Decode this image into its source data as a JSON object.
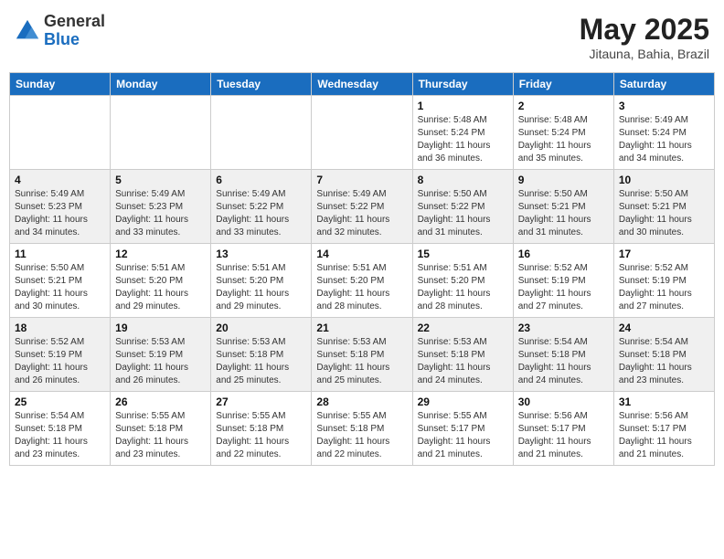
{
  "header": {
    "logo_general": "General",
    "logo_blue": "Blue",
    "month_title": "May 2025",
    "subtitle": "Jitauna, Bahia, Brazil"
  },
  "weekdays": [
    "Sunday",
    "Monday",
    "Tuesday",
    "Wednesday",
    "Thursday",
    "Friday",
    "Saturday"
  ],
  "weeks": [
    [
      {
        "day": "",
        "info": ""
      },
      {
        "day": "",
        "info": ""
      },
      {
        "day": "",
        "info": ""
      },
      {
        "day": "",
        "info": ""
      },
      {
        "day": "1",
        "info": "Sunrise: 5:48 AM\nSunset: 5:24 PM\nDaylight: 11 hours and 36 minutes."
      },
      {
        "day": "2",
        "info": "Sunrise: 5:48 AM\nSunset: 5:24 PM\nDaylight: 11 hours and 35 minutes."
      },
      {
        "day": "3",
        "info": "Sunrise: 5:49 AM\nSunset: 5:24 PM\nDaylight: 11 hours and 34 minutes."
      }
    ],
    [
      {
        "day": "4",
        "info": "Sunrise: 5:49 AM\nSunset: 5:23 PM\nDaylight: 11 hours and 34 minutes."
      },
      {
        "day": "5",
        "info": "Sunrise: 5:49 AM\nSunset: 5:23 PM\nDaylight: 11 hours and 33 minutes."
      },
      {
        "day": "6",
        "info": "Sunrise: 5:49 AM\nSunset: 5:22 PM\nDaylight: 11 hours and 33 minutes."
      },
      {
        "day": "7",
        "info": "Sunrise: 5:49 AM\nSunset: 5:22 PM\nDaylight: 11 hours and 32 minutes."
      },
      {
        "day": "8",
        "info": "Sunrise: 5:50 AM\nSunset: 5:22 PM\nDaylight: 11 hours and 31 minutes."
      },
      {
        "day": "9",
        "info": "Sunrise: 5:50 AM\nSunset: 5:21 PM\nDaylight: 11 hours and 31 minutes."
      },
      {
        "day": "10",
        "info": "Sunrise: 5:50 AM\nSunset: 5:21 PM\nDaylight: 11 hours and 30 minutes."
      }
    ],
    [
      {
        "day": "11",
        "info": "Sunrise: 5:50 AM\nSunset: 5:21 PM\nDaylight: 11 hours and 30 minutes."
      },
      {
        "day": "12",
        "info": "Sunrise: 5:51 AM\nSunset: 5:20 PM\nDaylight: 11 hours and 29 minutes."
      },
      {
        "day": "13",
        "info": "Sunrise: 5:51 AM\nSunset: 5:20 PM\nDaylight: 11 hours and 29 minutes."
      },
      {
        "day": "14",
        "info": "Sunrise: 5:51 AM\nSunset: 5:20 PM\nDaylight: 11 hours and 28 minutes."
      },
      {
        "day": "15",
        "info": "Sunrise: 5:51 AM\nSunset: 5:20 PM\nDaylight: 11 hours and 28 minutes."
      },
      {
        "day": "16",
        "info": "Sunrise: 5:52 AM\nSunset: 5:19 PM\nDaylight: 11 hours and 27 minutes."
      },
      {
        "day": "17",
        "info": "Sunrise: 5:52 AM\nSunset: 5:19 PM\nDaylight: 11 hours and 27 minutes."
      }
    ],
    [
      {
        "day": "18",
        "info": "Sunrise: 5:52 AM\nSunset: 5:19 PM\nDaylight: 11 hours and 26 minutes."
      },
      {
        "day": "19",
        "info": "Sunrise: 5:53 AM\nSunset: 5:19 PM\nDaylight: 11 hours and 26 minutes."
      },
      {
        "day": "20",
        "info": "Sunrise: 5:53 AM\nSunset: 5:18 PM\nDaylight: 11 hours and 25 minutes."
      },
      {
        "day": "21",
        "info": "Sunrise: 5:53 AM\nSunset: 5:18 PM\nDaylight: 11 hours and 25 minutes."
      },
      {
        "day": "22",
        "info": "Sunrise: 5:53 AM\nSunset: 5:18 PM\nDaylight: 11 hours and 24 minutes."
      },
      {
        "day": "23",
        "info": "Sunrise: 5:54 AM\nSunset: 5:18 PM\nDaylight: 11 hours and 24 minutes."
      },
      {
        "day": "24",
        "info": "Sunrise: 5:54 AM\nSunset: 5:18 PM\nDaylight: 11 hours and 23 minutes."
      }
    ],
    [
      {
        "day": "25",
        "info": "Sunrise: 5:54 AM\nSunset: 5:18 PM\nDaylight: 11 hours and 23 minutes."
      },
      {
        "day": "26",
        "info": "Sunrise: 5:55 AM\nSunset: 5:18 PM\nDaylight: 11 hours and 23 minutes."
      },
      {
        "day": "27",
        "info": "Sunrise: 5:55 AM\nSunset: 5:18 PM\nDaylight: 11 hours and 22 minutes."
      },
      {
        "day": "28",
        "info": "Sunrise: 5:55 AM\nSunset: 5:18 PM\nDaylight: 11 hours and 22 minutes."
      },
      {
        "day": "29",
        "info": "Sunrise: 5:55 AM\nSunset: 5:17 PM\nDaylight: 11 hours and 21 minutes."
      },
      {
        "day": "30",
        "info": "Sunrise: 5:56 AM\nSunset: 5:17 PM\nDaylight: 11 hours and 21 minutes."
      },
      {
        "day": "31",
        "info": "Sunrise: 5:56 AM\nSunset: 5:17 PM\nDaylight: 11 hours and 21 minutes."
      }
    ]
  ]
}
